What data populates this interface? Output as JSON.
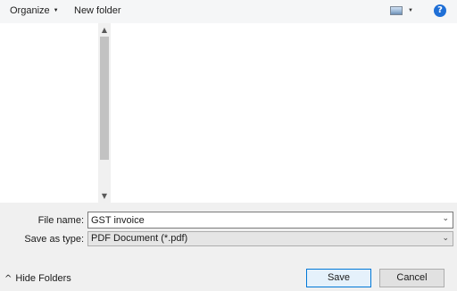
{
  "toolbar": {
    "organize_label": "Organize",
    "new_folder_label": "New folder",
    "help_label": "?"
  },
  "form": {
    "file_name_label": "File name:",
    "file_name_value": "GST invoice",
    "save_as_type_label": "Save as type:",
    "save_as_type_value": "PDF Document (*.pdf)"
  },
  "footer": {
    "hide_folders_label": "Hide Folders",
    "save_label": "Save",
    "cancel_label": "Cancel"
  },
  "icons": {
    "organize_caret": "caret-down-icon",
    "view": "change-view-icon",
    "view_caret": "caret-down-icon",
    "help": "help-icon",
    "scroll_up": "chevron-up-icon",
    "scroll_down": "chevron-down-icon",
    "name_dropdown": "chevron-down-icon",
    "type_dropdown": "chevron-down-icon",
    "hide_folders": "chevron-up-icon"
  },
  "colors": {
    "help_icon": "#1f6fd6",
    "primary_button_border": "#0078d7"
  }
}
